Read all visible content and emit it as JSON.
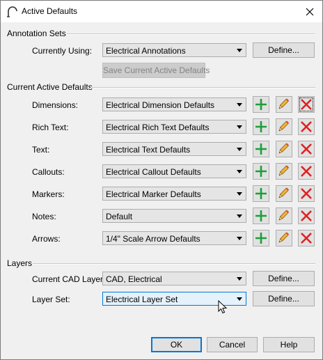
{
  "window": {
    "title": "Active Defaults"
  },
  "annotation_sets": {
    "heading": "Annotation Sets",
    "currently_using_label": "Currently Using:",
    "currently_using_value": "Electrical Annotations",
    "define_label": "Define...",
    "save_label": "Save Current Active Defaults"
  },
  "current_active_defaults": {
    "heading": "Current Active Defaults",
    "rows": [
      {
        "label": "Dimensions:",
        "value": "Electrical Dimension Defaults"
      },
      {
        "label": "Rich Text:",
        "value": "Electrical Rich Text Defaults"
      },
      {
        "label": "Text:",
        "value": "Electrical Text Defaults"
      },
      {
        "label": "Callouts:",
        "value": "Electrical Callout Defaults"
      },
      {
        "label": "Markers:",
        "value": "Electrical Marker Defaults"
      },
      {
        "label": "Notes:",
        "value": "Default"
      },
      {
        "label": "Arrows:",
        "value": "1/4\" Scale Arrow Defaults"
      }
    ]
  },
  "layers": {
    "heading": "Layers",
    "cad_layer_label": "Current CAD Layer:",
    "cad_layer_value": "CAD, Electrical",
    "layer_set_label": "Layer Set:",
    "layer_set_value": "Electrical Layer Set",
    "define_label": "Define..."
  },
  "footer": {
    "ok_label": "OK",
    "cancel_label": "Cancel",
    "help_label": "Help"
  },
  "icons": {
    "add": "plus-icon",
    "edit": "pencil-icon",
    "delete": "red-x-icon",
    "add_color": "#1e9e3a",
    "delete_color": "#e02020"
  }
}
